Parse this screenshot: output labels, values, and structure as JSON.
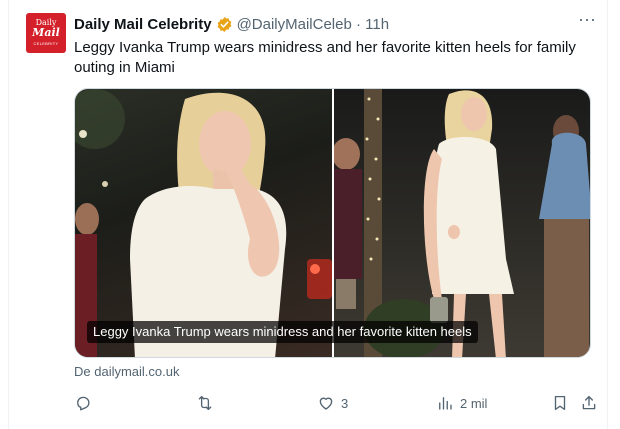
{
  "account": {
    "avatar": {
      "line1": "Daily",
      "line2": "Mail",
      "line3": "CELEBRITY",
      "bg_color": "#d3202a"
    },
    "name": "Daily Mail Celebrity",
    "handle_time": "@DailyMailCeleb · 11h",
    "verified_color": "#e8a317"
  },
  "tweet": {
    "text": "Leggy Ivanka Trump wears minidress and her favorite kitten heels for family outing in Miami",
    "media_caption": "Leggy Ivanka Trump wears minidress and her favorite kitten heels",
    "source": "De dailymail.co.uk"
  },
  "actions": {
    "reply_icon": "reply-icon",
    "retweet_icon": "retweet-icon",
    "like_count": "3",
    "views_count": "2 mil",
    "bookmark_icon": "bookmark-icon",
    "share_icon": "share-icon"
  }
}
